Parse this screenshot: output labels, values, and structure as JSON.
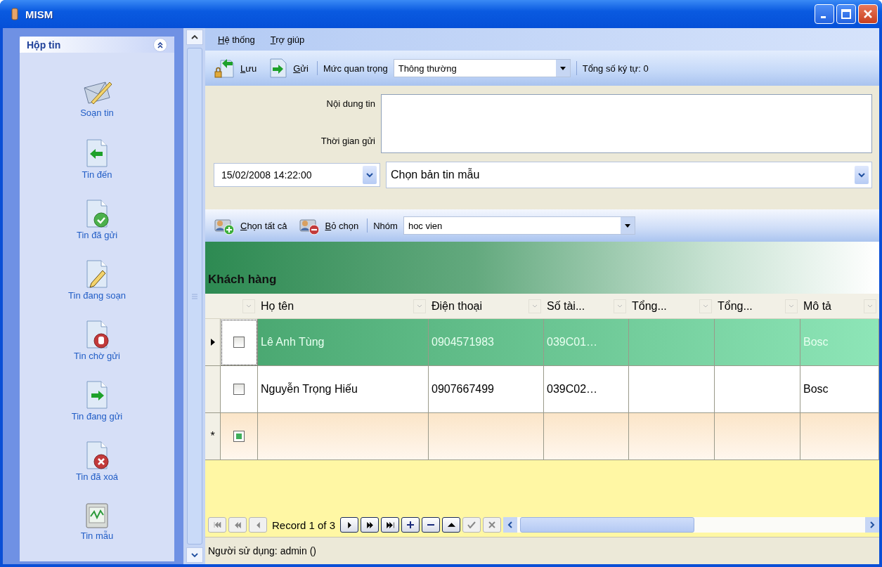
{
  "window": {
    "title": "MISM"
  },
  "sidebar": {
    "title": "Hộp tin",
    "expanded": true,
    "items": [
      {
        "label": "Soạn tin",
        "kind": "compose"
      },
      {
        "label": "Tin đến",
        "kind": "inbox"
      },
      {
        "label": "Tin đã gửi",
        "kind": "sent"
      },
      {
        "label": "Tin đang soạn",
        "kind": "draft"
      },
      {
        "label": "Tin chờ gửi",
        "kind": "pending"
      },
      {
        "label": "Tin đang gửi",
        "kind": "sending"
      },
      {
        "label": "Tin đã xoá",
        "kind": "deleted"
      },
      {
        "label": "Tin mẫu",
        "kind": "template"
      }
    ]
  },
  "menu": [
    "Hệ thống",
    "Trợ giúp"
  ],
  "toolbar": {
    "buttons": [
      {
        "label": "Lưu",
        "kind": "save"
      },
      {
        "label": "Gửi",
        "kind": "send"
      }
    ],
    "priority_label": "Mức quan trọng",
    "priority_value": "Thông thường",
    "char_count": "Tổng số ký tự: 0"
  },
  "form": {
    "content_label": "Nội dung tin",
    "time_label": "Thời gian gửi",
    "send_time": "15/02/2008 14:22:00",
    "template_placeholder": "Chọn bản tin mẫu"
  },
  "contacts_toolbar": {
    "buttons": [
      {
        "label": "Chọn tất cả",
        "kind": "add"
      },
      {
        "label": "Bỏ chọn",
        "kind": "remove"
      }
    ],
    "group_label": "Nhóm",
    "group_value": "hoc vien"
  },
  "table": {
    "title": "Khách hàng",
    "columns": [
      "Họ tên",
      "Điện thoại",
      "Số tài...",
      "Tổng...",
      "Tổng...",
      "Mô tả"
    ],
    "rows": [
      {
        "kind": "data",
        "selected": true,
        "checked": false,
        "cells": [
          "Lê Anh Tùng",
          "0904571983",
          "039C01…",
          "",
          "",
          "Bosc"
        ]
      },
      {
        "kind": "data",
        "selected": false,
        "checked": false,
        "cells": [
          "Nguyễn Trọng Hiếu",
          "0907667499",
          "039C02…",
          "",
          "",
          "Bosc"
        ]
      },
      {
        "kind": "new",
        "marker": "*",
        "selected": false,
        "checked": true
      }
    ]
  },
  "navigator": {
    "record": "Record 1 of 3",
    "buttons": [
      {
        "kind": "first",
        "disabled": true
      },
      {
        "kind": "prev-page",
        "disabled": true
      },
      {
        "kind": "prev",
        "disabled": true
      },
      {
        "kind": "record"
      },
      {
        "kind": "next",
        "disabled": false
      },
      {
        "kind": "next-page",
        "disabled": false
      },
      {
        "kind": "last",
        "disabled": false
      },
      {
        "kind": "add",
        "disabled": false
      },
      {
        "kind": "delete",
        "disabled": false
      },
      {
        "kind": "up",
        "disabled": false
      },
      {
        "kind": "confirm",
        "disabled": true
      },
      {
        "kind": "cancel",
        "disabled": true
      }
    ]
  },
  "status_bar": "Người sử dụng: admin ()"
}
